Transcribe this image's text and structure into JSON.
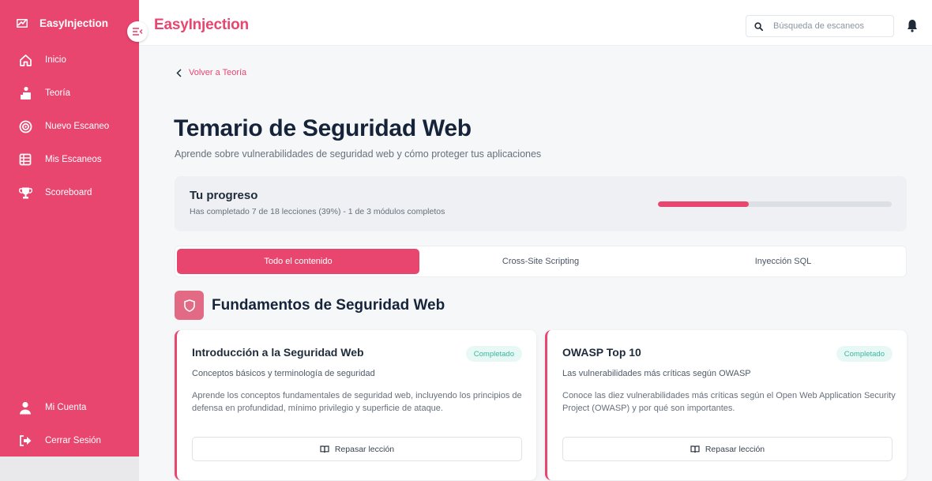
{
  "sidebar": {
    "brand": "EasyInjection",
    "items": [
      {
        "label": "Inicio",
        "icon": "home-icon"
      },
      {
        "label": "Teoría",
        "icon": "teacher-icon"
      },
      {
        "label": "Nuevo Escaneo",
        "icon": "target-icon"
      },
      {
        "label": "Mis Escaneos",
        "icon": "list-icon"
      },
      {
        "label": "Scoreboard",
        "icon": "trophy-icon"
      }
    ],
    "bottom_items": [
      {
        "label": "Mi Cuenta",
        "icon": "user-icon"
      },
      {
        "label": "Cerrar Sesión",
        "icon": "logout-icon"
      }
    ],
    "color": "#e8456f"
  },
  "header": {
    "title": "EasyInjection",
    "search_placeholder": "Búsqueda de escaneos"
  },
  "main": {
    "back_label": "Volver a Teoría",
    "title": "Temario de Seguridad Web",
    "subtitle": "Aprende sobre vulnerabilidades de seguridad web y cómo proteger tus aplicaciones",
    "progress": {
      "title": "Tu progreso",
      "description": "Has completado 7 de 18 lecciones (39%) - 1 de 3 módulos completos",
      "percent": 39
    },
    "tabs": [
      {
        "label": "Todo el contenido",
        "active": true
      },
      {
        "label": "Cross-Site Scripting",
        "active": false
      },
      {
        "label": "Inyección SQL",
        "active": false
      }
    ],
    "module": {
      "title": "Fundamentos de Seguridad Web",
      "icon": "shield-icon"
    },
    "lessons": [
      {
        "title": "Introducción a la Seguridad Web",
        "badge": "Completado",
        "subtitle": "Conceptos básicos y terminología de seguridad",
        "description": "Aprende los conceptos fundamentales de seguridad web, incluyendo los principios de defensa en profundidad, mínimo privilegio y superficie de ataque.",
        "button": "Repasar lección"
      },
      {
        "title": "OWASP Top 10",
        "badge": "Completado",
        "subtitle": "Las vulnerabilidades más críticas según OWASP",
        "description": "Conoce las diez vulnerabilidades más críticas según el Open Web Application Security Project (OWASP) y por qué son importantes.",
        "button": "Repasar lección"
      }
    ]
  }
}
